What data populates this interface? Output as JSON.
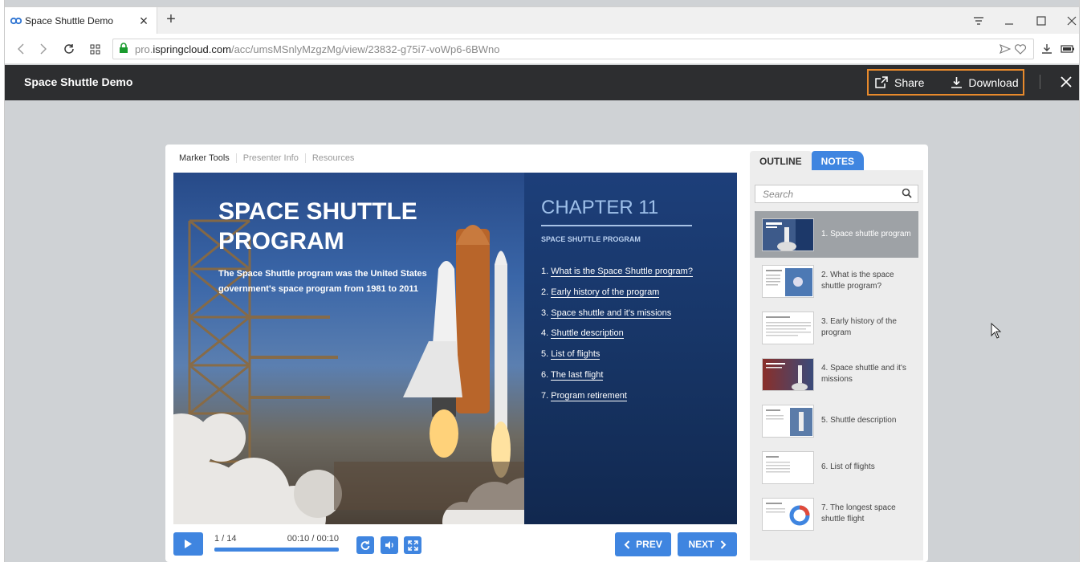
{
  "browser": {
    "tab_title": "Space Shuttle Demo",
    "url_prefix": "pro.",
    "url_domain": "ispringcloud.com",
    "url_path": "/acc/umsMSnlyMzgzMg/view/23832-g75i7-voWp6-6BWno"
  },
  "app": {
    "title": "Space Shuttle Demo",
    "share_label": "Share",
    "download_label": "Download"
  },
  "player": {
    "top_tabs": [
      "Marker Tools",
      "Presenter Info",
      "Resources"
    ],
    "slide": {
      "title": "SPACE SHUTTLE PROGRAM",
      "description": "The Space Shuttle program was the United States government's space program from 1981 to 2011",
      "chapter": "CHAPTER 11",
      "chapter_sub": "SPACE SHUTTLE PROGRAM",
      "toc": [
        "What is the Space Shuttle program?",
        "Early history of the program",
        "Space shuttle and it's missions",
        "Shuttle description",
        "List of flights",
        "The last flight",
        "Program retirement"
      ]
    },
    "controls": {
      "slide_counter": "1 / 14",
      "time": "00:10 / 00:10",
      "progress": 1.0,
      "prev_label": "PREV",
      "next_label": "NEXT"
    }
  },
  "sidebar": {
    "tab_outline": "OUTLINE",
    "tab_notes": "NOTES",
    "search_placeholder": "Search",
    "items": [
      "1. Space shuttle program",
      "2. What is the space shuttle program?",
      "3. Early history of the program",
      "4. Space shuttle and it's missions",
      "5. Shuttle description",
      "6. List of flights",
      "7. The longest space shuttle flight"
    ]
  },
  "colors": {
    "accent": "#3f85e0",
    "header_bg": "#2d2e30",
    "highlight_border": "#e88a2c"
  }
}
